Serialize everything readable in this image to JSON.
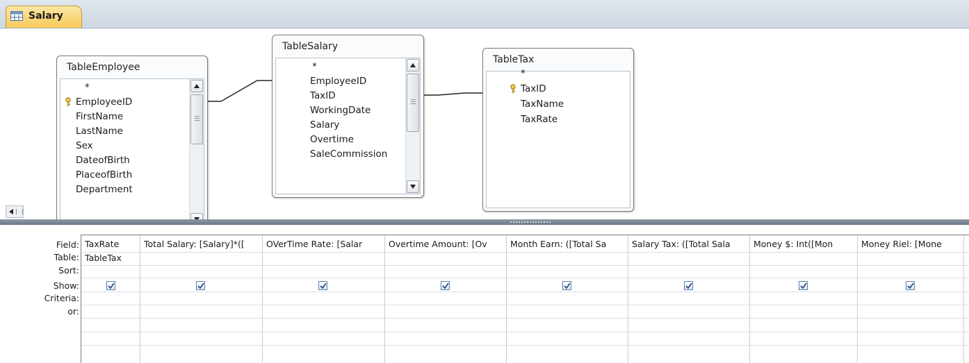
{
  "tab": {
    "label": "Salary",
    "icon": "query-icon"
  },
  "tables": [
    {
      "title": "TableEmployee",
      "fields": [
        "*",
        "EmployeeID",
        "FirstName",
        "LastName",
        "Sex",
        "DateofBirth",
        "PlaceofBirth",
        "Department"
      ],
      "key_field": "EmployeeID"
    },
    {
      "title": "TableSalary",
      "fields": [
        "*",
        "EmployeeID",
        "TaxID",
        "WorkingDate",
        "Salary",
        "Overtime",
        "SaleCommission"
      ]
    },
    {
      "title": "TableTax",
      "fields": [
        "*",
        "TaxID",
        "TaxName",
        "TaxRate"
      ],
      "key_field": "TaxID"
    }
  ],
  "grid": {
    "row_labels": [
      "Field:",
      "Table:",
      "Sort:",
      "Show:",
      "Criteria:",
      "or:"
    ],
    "columns": [
      {
        "field": "TaxRate",
        "table": "TableTax",
        "show": true
      },
      {
        "field": "Total Salary: [Salary]*([",
        "table": "",
        "show": true
      },
      {
        "field": "OVerTime Rate: [Salar",
        "table": "",
        "show": true
      },
      {
        "field": "Overtime Amount: [Ov",
        "table": "",
        "show": true
      },
      {
        "field": "Month Earn: ([Total Sa",
        "table": "",
        "show": true
      },
      {
        "field": "Salary Tax: ([Total Sala",
        "table": "",
        "show": true
      },
      {
        "field": "Money $: Int([Mon",
        "table": "",
        "show": true
      },
      {
        "field": "Money Riel: [Mone",
        "table": "",
        "show": true
      }
    ]
  },
  "colors": {
    "tab_accent": "#f7c95a",
    "splitter": "#7b8795",
    "checkbox_border": "#5d7fa8"
  }
}
